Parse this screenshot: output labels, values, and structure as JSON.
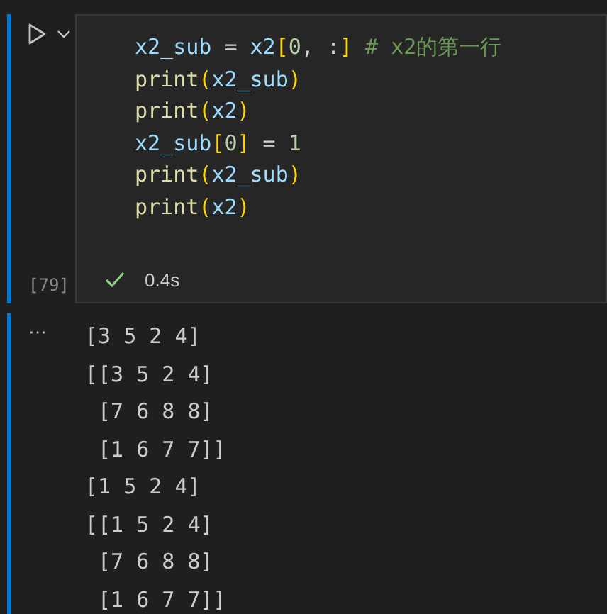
{
  "cell": {
    "execution_count": "[79]",
    "succeeded": true,
    "duration": "0.4s",
    "code": [
      [
        {
          "text": "x2_sub",
          "kind": "var"
        },
        {
          "text": " = ",
          "kind": "plain"
        },
        {
          "text": "x2",
          "kind": "var"
        },
        {
          "text": "[",
          "kind": "bracket"
        },
        {
          "text": "0",
          "kind": "num"
        },
        {
          "text": ", :",
          "kind": "plain"
        },
        {
          "text": "]",
          "kind": "bracket"
        },
        {
          "text": " # x2的第一行",
          "kind": "comment"
        }
      ],
      [
        {
          "text": "print",
          "kind": "func"
        },
        {
          "text": "(",
          "kind": "bracket"
        },
        {
          "text": "x2_sub",
          "kind": "var"
        },
        {
          "text": ")",
          "kind": "bracket"
        }
      ],
      [
        {
          "text": "print",
          "kind": "func"
        },
        {
          "text": "(",
          "kind": "bracket"
        },
        {
          "text": "x2",
          "kind": "var"
        },
        {
          "text": ")",
          "kind": "bracket"
        }
      ],
      [
        {
          "text": "x2_sub",
          "kind": "var"
        },
        {
          "text": "[",
          "kind": "bracket"
        },
        {
          "text": "0",
          "kind": "num"
        },
        {
          "text": "]",
          "kind": "bracket"
        },
        {
          "text": " = ",
          "kind": "plain"
        },
        {
          "text": "1",
          "kind": "num"
        }
      ],
      [
        {
          "text": "print",
          "kind": "func"
        },
        {
          "text": "(",
          "kind": "bracket"
        },
        {
          "text": "x2_sub",
          "kind": "var"
        },
        {
          "text": ")",
          "kind": "bracket"
        }
      ],
      [
        {
          "text": "print",
          "kind": "func"
        },
        {
          "text": "(",
          "kind": "bracket"
        },
        {
          "text": "x2",
          "kind": "var"
        },
        {
          "text": ")",
          "kind": "bracket"
        }
      ]
    ]
  },
  "output": {
    "marker": "···",
    "lines": [
      "[3 5 2 4]",
      "[[3 5 2 4]",
      " [7 6 8 8]",
      " [1 6 7 7]]",
      "[1 5 2 4]",
      "[[1 5 2 4]",
      " [7 6 8 8]",
      " [1 6 7 7]]"
    ]
  }
}
